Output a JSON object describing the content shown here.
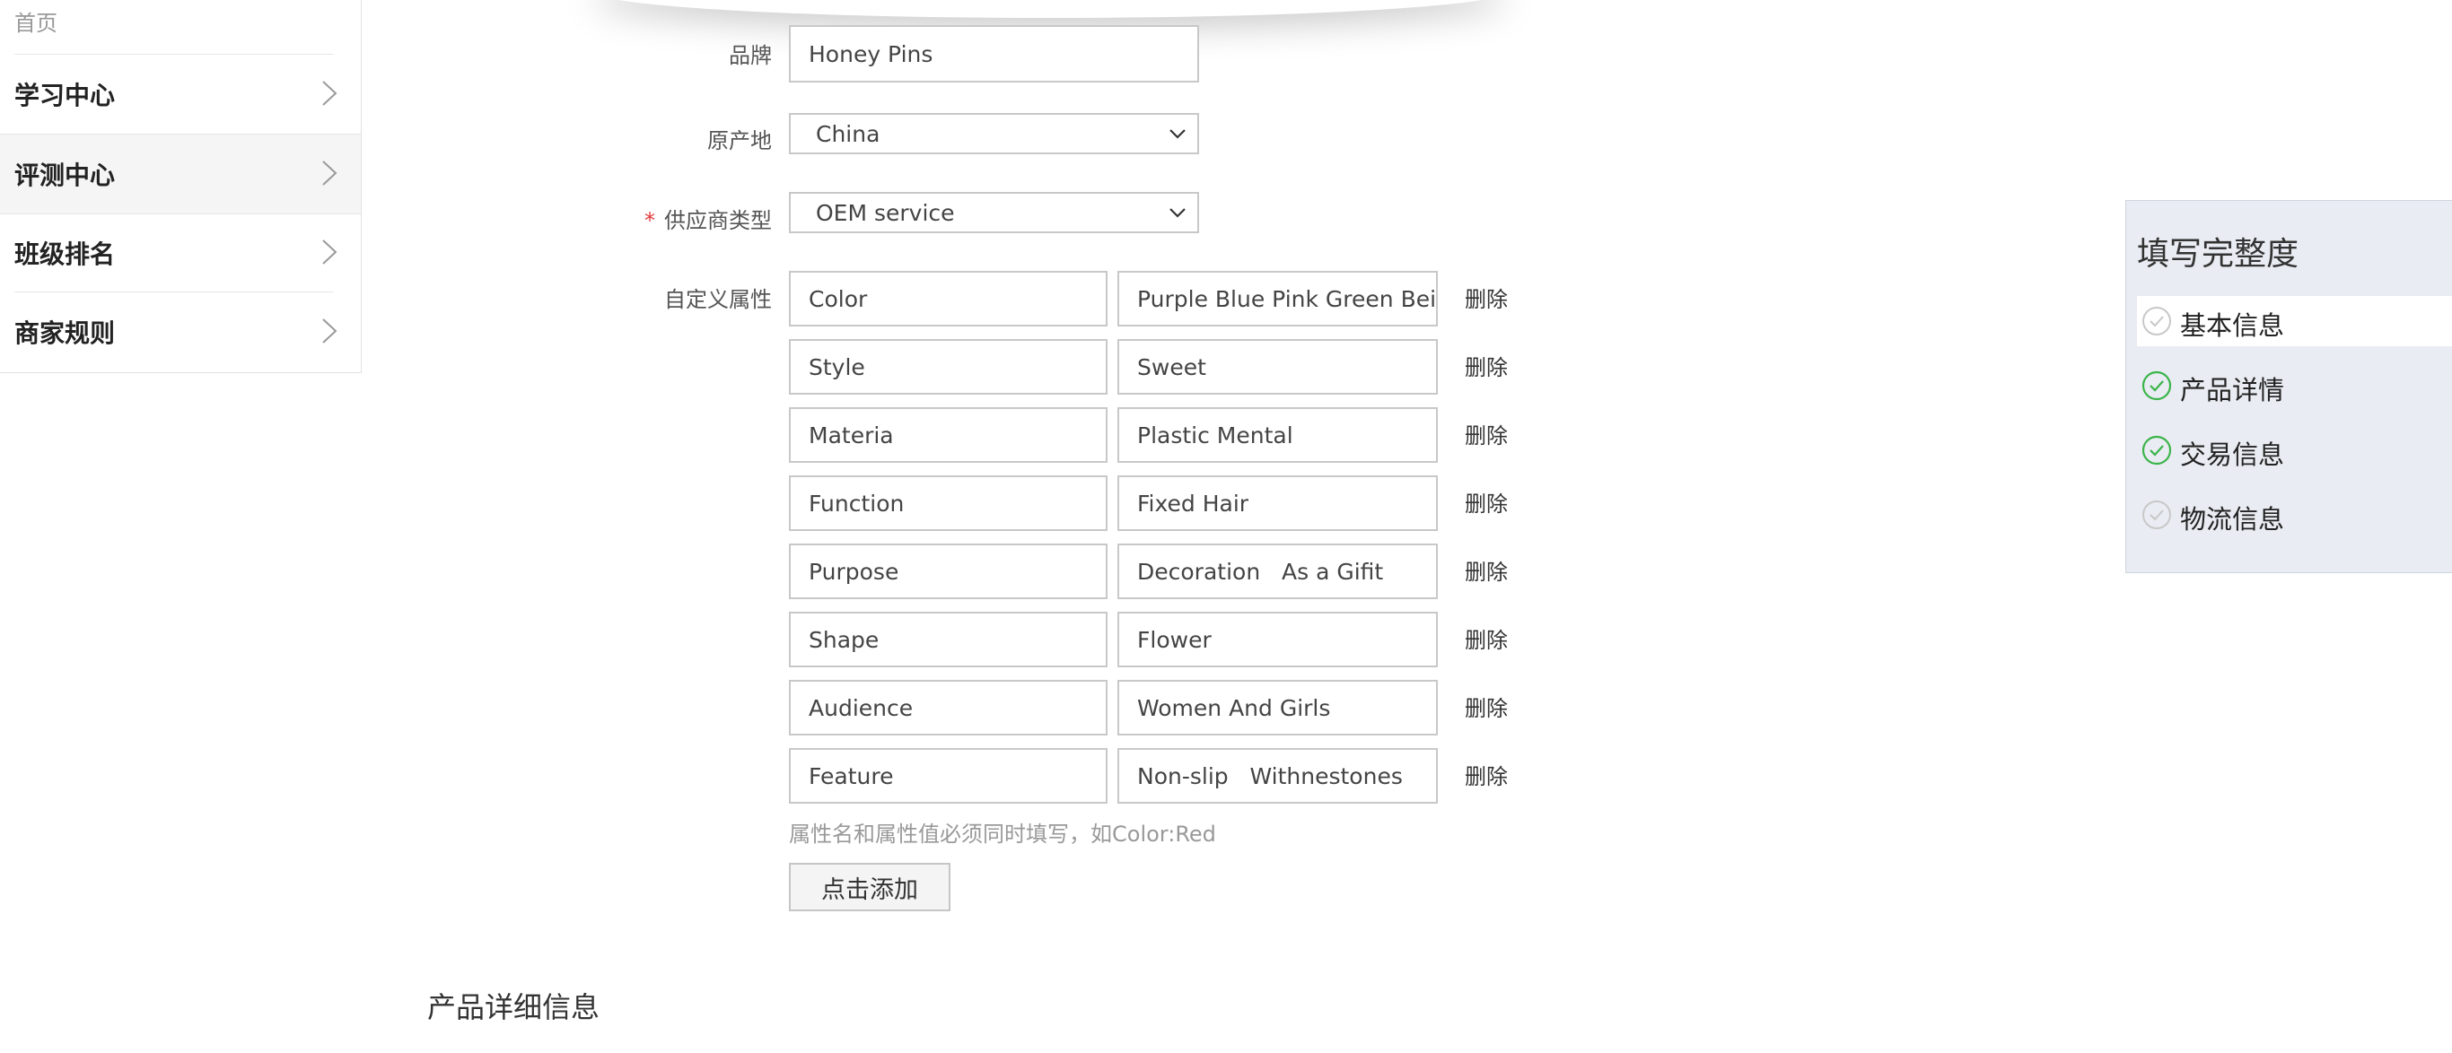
{
  "sidebar": {
    "home": "首页",
    "items": [
      {
        "label": "学习中心"
      },
      {
        "label": "评测中心"
      },
      {
        "label": "班级排名"
      },
      {
        "label": "商家规则"
      }
    ]
  },
  "form": {
    "brand": {
      "label": "品牌",
      "value": "Honey Pins"
    },
    "origin": {
      "label": "原产地",
      "value": "China"
    },
    "supplier": {
      "required_mark": "*",
      "label": "供应商类型",
      "value": "OEM service"
    },
    "custom_attrs_label": "自定义属性",
    "attributes": [
      {
        "name": "Color",
        "value": "Purple Blue Pink Green Beige",
        "delete": "删除"
      },
      {
        "name": "Style",
        "value": "Sweet",
        "delete": "删除"
      },
      {
        "name": "Materia",
        "value": "Plastic Mental",
        "delete": "删除"
      },
      {
        "name": "Function",
        "value": "Fixed Hair",
        "delete": "删除"
      },
      {
        "name": "Purpose",
        "value": "Decoration   As a Gifit",
        "delete": "删除"
      },
      {
        "name": "Shape",
        "value": "Flower",
        "delete": "删除"
      },
      {
        "name": "Audience",
        "value": "Women And Girls",
        "delete": "删除"
      },
      {
        "name": "Feature",
        "value": "Non-slip   Withnestones",
        "delete": "删除"
      }
    ],
    "hint": "属性名和属性值必须同时填写，如Color:Red",
    "add_button": "点击添加"
  },
  "section_title": "产品详细信息",
  "completeness": {
    "title": "填写完整度",
    "items": [
      {
        "label": "基本信息",
        "done": false
      },
      {
        "label": "产品详情",
        "done": true
      },
      {
        "label": "交易信息",
        "done": true
      },
      {
        "label": "物流信息",
        "done": false
      }
    ],
    "colors": {
      "done": "#3bb44a",
      "pending": "#c8c8c8"
    }
  }
}
